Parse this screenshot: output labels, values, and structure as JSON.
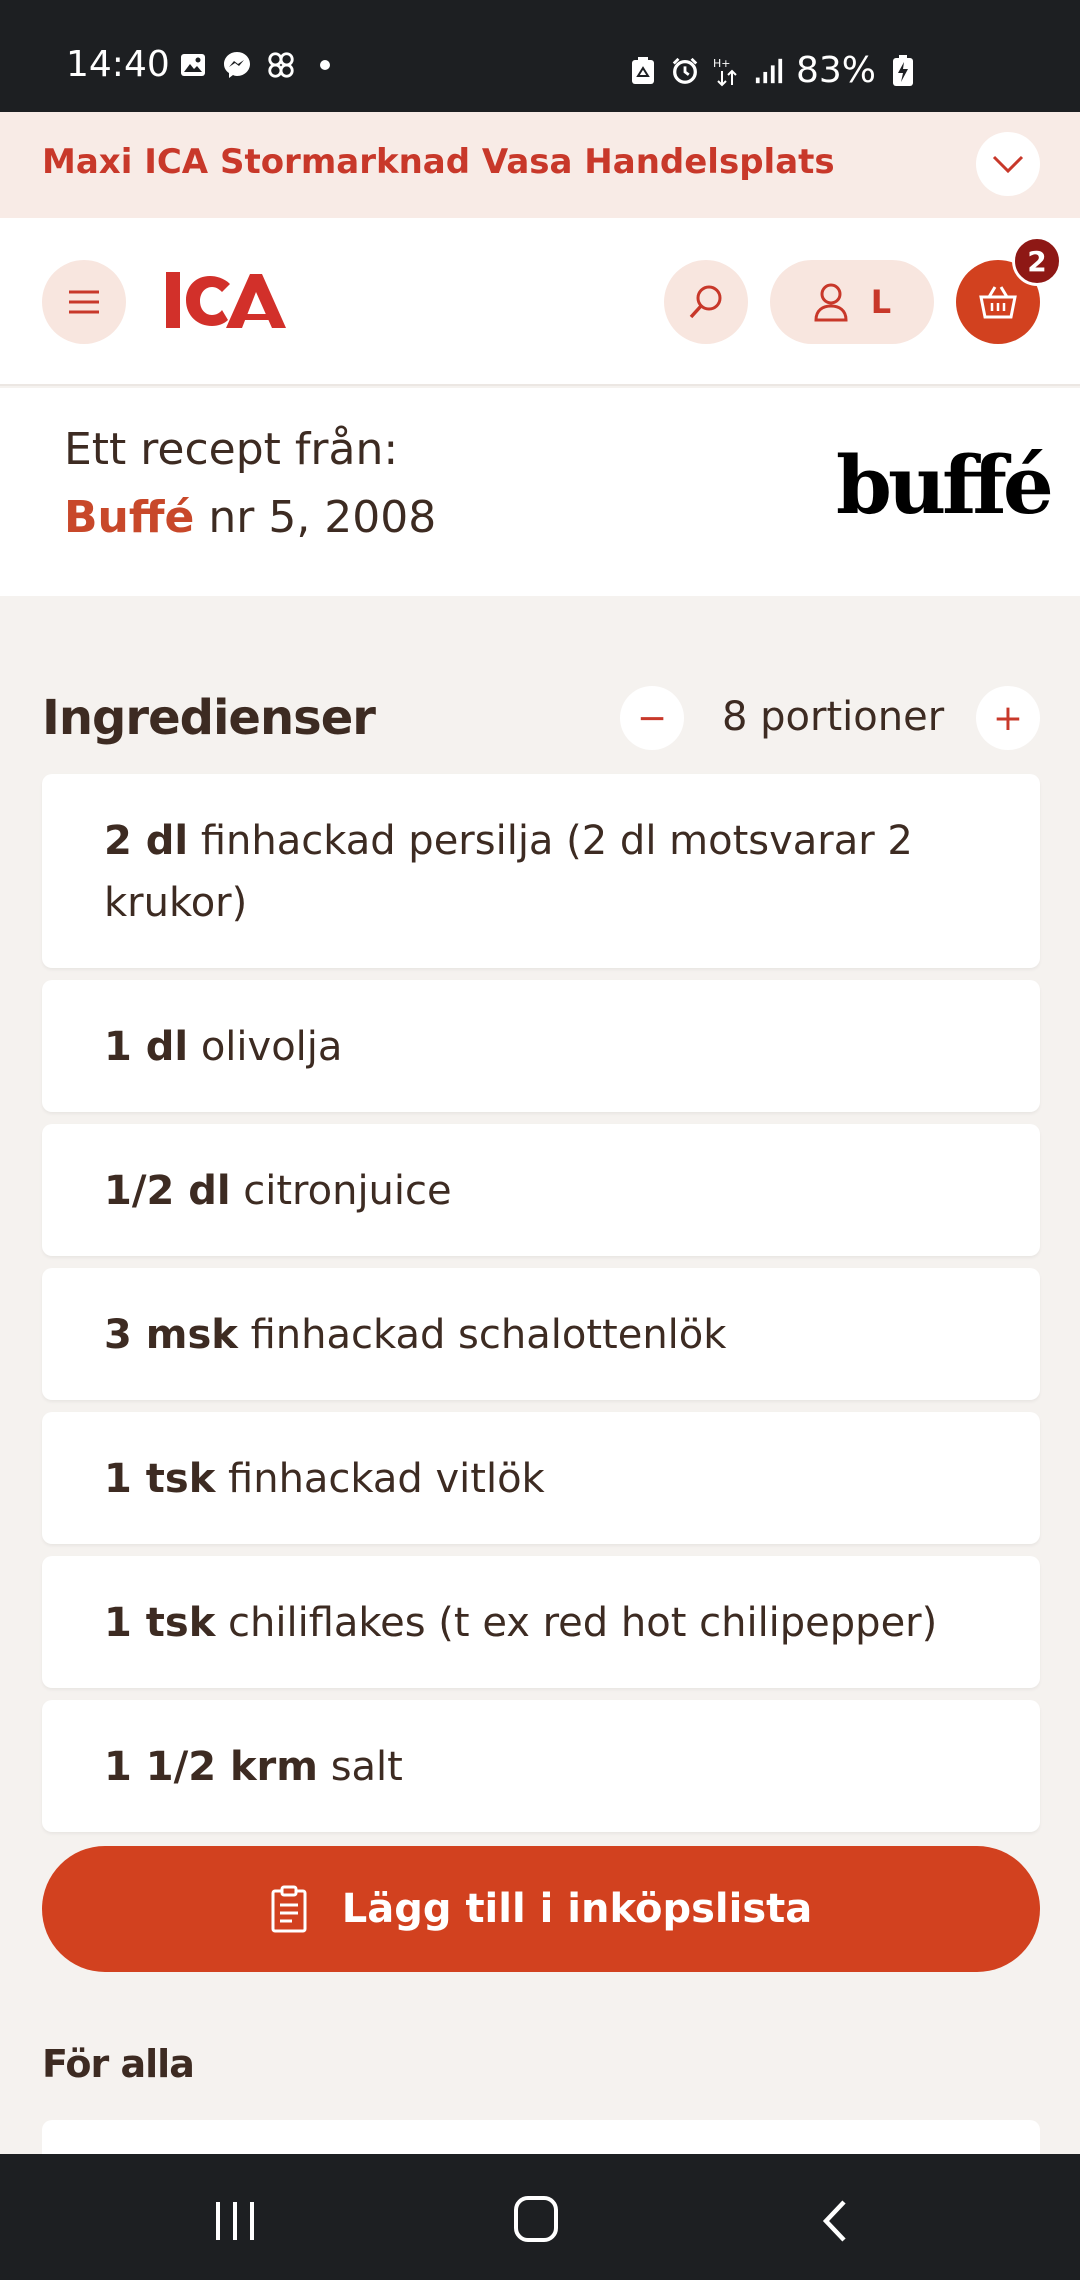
{
  "status_bar": {
    "time": "14:40",
    "battery_percent": "83%",
    "left_icons": [
      "image-icon",
      "messenger-icon",
      "pinwheel-icon",
      "dot-icon"
    ],
    "right_icons": [
      "recycle-icon",
      "alarm-icon",
      "data-arrows-icon",
      "signal-icon",
      "battery-charging-icon"
    ]
  },
  "store": {
    "name": "Maxi ICA Stormarknad Vasa Handelsplats",
    "toggle_icon": "chevron-down-icon"
  },
  "header": {
    "logo_text": "ICA",
    "account_initial": "L",
    "cart_count": "2"
  },
  "recipe_source": {
    "prefix": "Ett recept från:",
    "magazine": "Buffé",
    "issue": "nr 5, 2008",
    "magazine_logo": "buffé"
  },
  "ingredients": {
    "title": "Ingredienser",
    "portions_label": "8 portioner",
    "minus_symbol": "−",
    "plus_symbol": "+",
    "items": [
      {
        "qty": "2 dl",
        "text": "finhackad persilja (2 dl motsvarar 2 krukor)"
      },
      {
        "qty": "1 dl",
        "text": "olivolja"
      },
      {
        "qty": "1/2 dl",
        "text": "citronjuice"
      },
      {
        "qty": "3 msk",
        "text": "finhackad schalottenlök"
      },
      {
        "qty": "1 tsk",
        "text": "finhackad vitlök"
      },
      {
        "qty": "1 tsk",
        "text": "chiliflakes (t ex red hot chilipepper)"
      },
      {
        "qty": "1 1/2 krm",
        "text": "salt"
      }
    ]
  },
  "actions": {
    "add_to_list_label": "Lägg till i inköpslista"
  },
  "next_section": {
    "title": "För alla"
  },
  "colors": {
    "brand_red": "#c8382a",
    "button_red": "#d2411f",
    "badge_red": "#8e1815",
    "store_bar_bg": "#f8ebe6",
    "page_bg": "#f5f2ef",
    "text_brown": "#3d2b22"
  }
}
